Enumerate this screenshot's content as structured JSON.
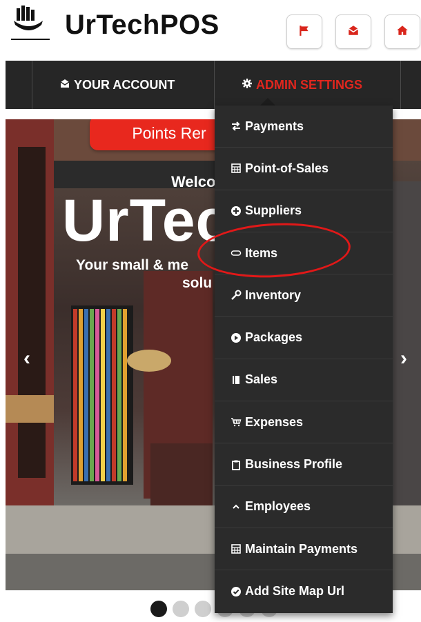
{
  "header": {
    "brand": "UrTechPOS",
    "buttons": [
      {
        "icon": "flag-icon",
        "color": "#d9261c"
      },
      {
        "icon": "envelope-icon",
        "color": "#d9261c"
      },
      {
        "icon": "home-icon",
        "color": "#d9261c"
      }
    ]
  },
  "nav": {
    "account_label": "YOUR ACCOUNT",
    "admin_label": "ADMIN SETTINGS",
    "account_color": "#ffffff",
    "admin_color": "#e0261e"
  },
  "hero": {
    "banner": "Points Rer",
    "welcome": "Welco",
    "title": "UrTec",
    "subtitle_line1": "Your small & me",
    "subtitle_line2": "solu",
    "prev_arrow": "‹",
    "next_arrow": "›"
  },
  "menu": {
    "items": [
      {
        "label": "Payments",
        "icon": "exchange-icon"
      },
      {
        "label": "Point-of-Sales",
        "icon": "calculator-icon"
      },
      {
        "label": "Suppliers",
        "icon": "plus-circle-icon"
      },
      {
        "label": "Items",
        "icon": "tag-icon"
      },
      {
        "label": "Inventory",
        "icon": "wrench-icon"
      },
      {
        "label": "Packages",
        "icon": "play-circle-icon"
      },
      {
        "label": "Sales",
        "icon": "book-icon"
      },
      {
        "label": "Expenses",
        "icon": "cart-icon"
      },
      {
        "label": "Business Profile",
        "icon": "clipboard-icon"
      },
      {
        "label": "Employees",
        "icon": "chevron-up-icon"
      },
      {
        "label": "Maintain Payments",
        "icon": "calculator-icon"
      },
      {
        "label": "Add Site Map Url",
        "icon": "check-circle-icon"
      }
    ]
  },
  "carousel": {
    "active_index": 0,
    "count": 6
  },
  "colors": {
    "accent_red": "#e11818",
    "navbar_bg": "#262626",
    "menu_bg": "#2b2b2b"
  }
}
